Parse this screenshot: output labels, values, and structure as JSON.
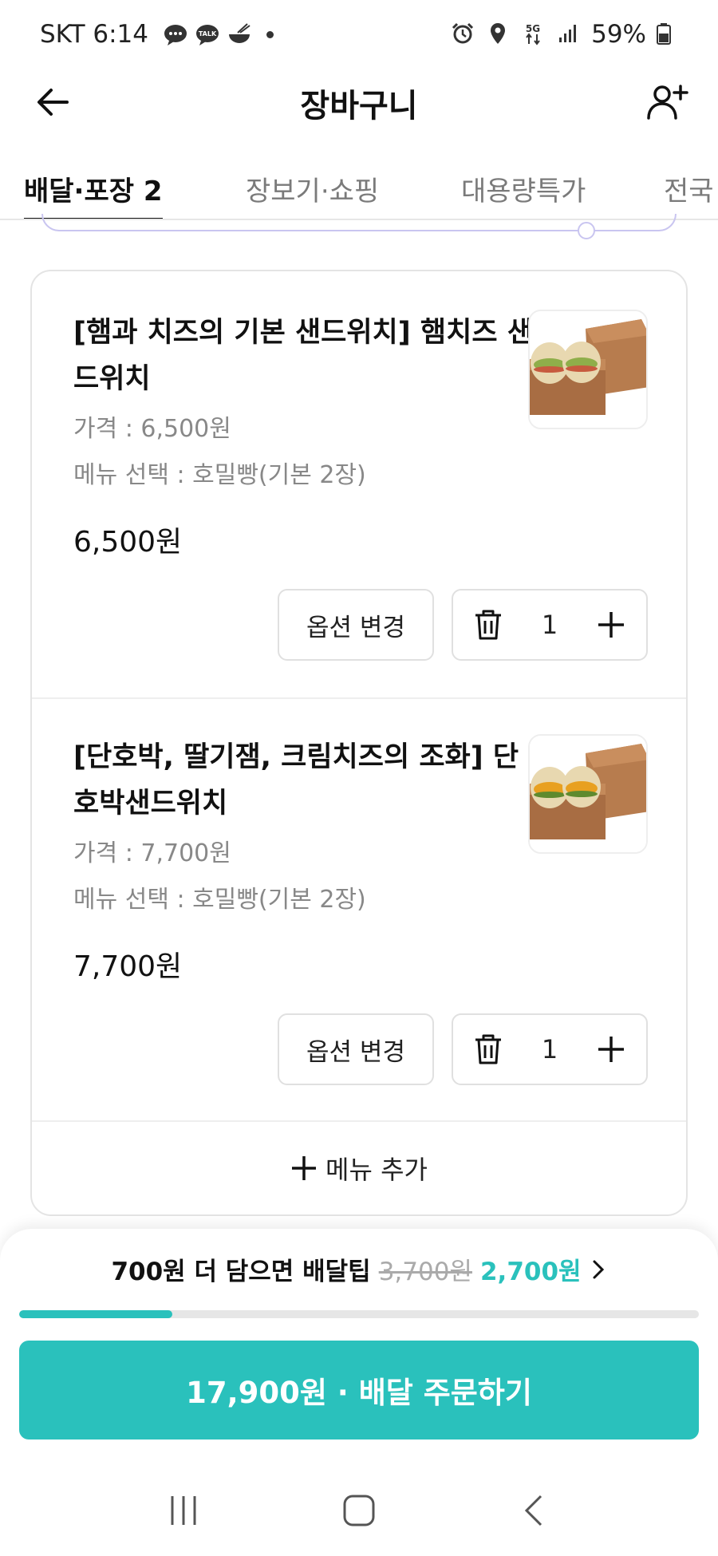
{
  "status_bar": {
    "carrier_time": "SKT 6:14",
    "battery": "59%",
    "icons": [
      "message-icon",
      "kakaotalk-icon",
      "food-bowl-icon",
      "alarm-icon",
      "location-icon",
      "5g-icon",
      "signal-icon",
      "battery-icon"
    ]
  },
  "header": {
    "title": "장바구니",
    "back_icon": "back-arrow-icon",
    "share_icon": "add-person-icon"
  },
  "tabs": [
    {
      "label": "배달·포장 2",
      "active": true
    },
    {
      "label": "장보기·쇼핑",
      "active": false
    },
    {
      "label": "대용량특가",
      "active": false
    },
    {
      "label": "전국",
      "active": false
    }
  ],
  "cart": {
    "items": [
      {
        "name": "[햄과 치즈의 기본 샌드위치] 햄치즈 샌드위치",
        "price_line": "가격 : 6,500원",
        "option_line": "메뉴 선택 : 호밀빵(기본 2장)",
        "total": "6,500원",
        "option_button": "옵션 변경",
        "quantity": "1"
      },
      {
        "name": "[단호박, 딸기잼, 크림치즈의 조화] 단호박샌드위치",
        "price_line": "가격 : 7,700원",
        "option_line": "메뉴 선택 : 호밀빵(기본 2장)",
        "total": "7,700원",
        "option_button": "옵션 변경",
        "quantity": "1"
      }
    ],
    "add_menu_label": "메뉴 추가"
  },
  "bottom": {
    "tip_message": "700원 더 담으면 배달팁",
    "tip_old": "3,700원",
    "tip_new": "2,700원",
    "progress_fraction": 0.225,
    "order_label": "17,900원 · 배달 주문하기"
  },
  "colors": {
    "accent": "#2ac1bc",
    "peek_border": "#c9c5f0"
  }
}
